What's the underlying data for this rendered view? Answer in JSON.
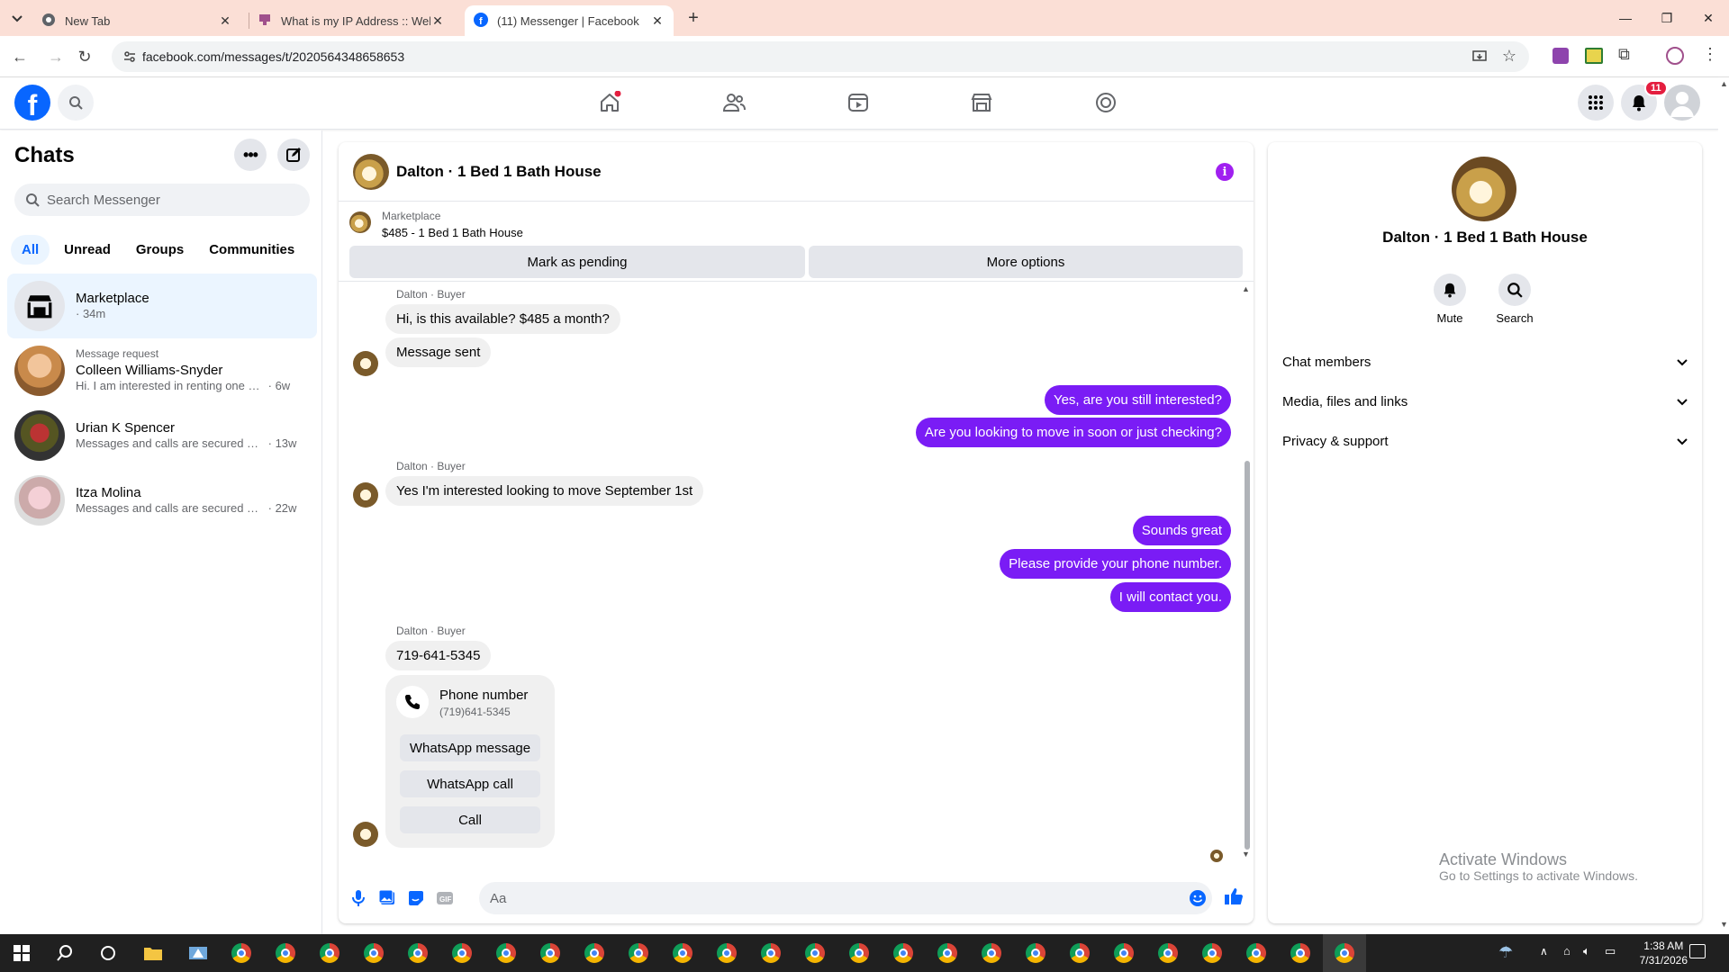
{
  "browser": {
    "tabs": [
      {
        "title": "New Tab"
      },
      {
        "title": "What is my IP Address :: WebBr"
      },
      {
        "title": "(11) Messenger | Facebook"
      }
    ],
    "url": "facebook.com/messages/t/2020564348658653"
  },
  "fb_nav": {
    "notification_count": "11"
  },
  "sidebar": {
    "title": "Chats",
    "search_placeholder": "Search Messenger",
    "filters": [
      "All",
      "Unread",
      "Groups",
      "Communities"
    ],
    "chats": [
      {
        "name": "Marketplace",
        "preview": "",
        "time": "· 34m"
      },
      {
        "request": "Message request",
        "name": "Colleen Williams-Snyder",
        "preview": "Hi. I am interested in renting one of your properties",
        "time": "· 6w"
      },
      {
        "name": "Urian K Spencer",
        "preview": "Messages and calls are secured with end-to-end encryption",
        "time": "· 13w"
      },
      {
        "name": "Itza Molina",
        "preview": "Messages and calls are secured with end-to-end encryption",
        "time": "· 22w"
      }
    ]
  },
  "conversation": {
    "title": "Dalton · 1 Bed 1 Bath House",
    "marketplace_label": "Marketplace",
    "listing": "$485 - 1 Bed 1 Bath House",
    "mark_pending": "Mark as pending",
    "more_options": "More options",
    "sender_label": "Dalton · Buyer",
    "messages": {
      "m1": "Hi, is this available? $485 a month?",
      "m2": "Message sent",
      "m3": "Yes, are you still interested?",
      "m4": "Are you looking to move in soon or just checking?",
      "m5": "Yes I'm interested looking to move September 1st",
      "m6": "Sounds great",
      "m7": "Please provide your phone number.",
      "m8": "I will contact you.",
      "m9": "719-641-5345"
    },
    "phone_card": {
      "title": "Phone number",
      "number": "(719)641-5345",
      "whatsapp_message": "WhatsApp message",
      "whatsapp_call": "WhatsApp call",
      "call": "Call"
    },
    "composer_placeholder": "Aa"
  },
  "details": {
    "name": "Dalton · 1 Bed 1 Bath House",
    "mute": "Mute",
    "search": "Search",
    "sections": [
      "Chat members",
      "Media, files and links",
      "Privacy & support"
    ]
  },
  "watermark": {
    "line1": "Activate Windows",
    "line2": "Go to Settings to activate Windows."
  },
  "taskbar": {
    "time": "1:38 AM",
    "date": "7/31/2026"
  },
  "colors": {
    "accent": "#0866ff",
    "outgoing_bubble": "#7a1cf5",
    "tab_strip": "#fbdfd6"
  }
}
